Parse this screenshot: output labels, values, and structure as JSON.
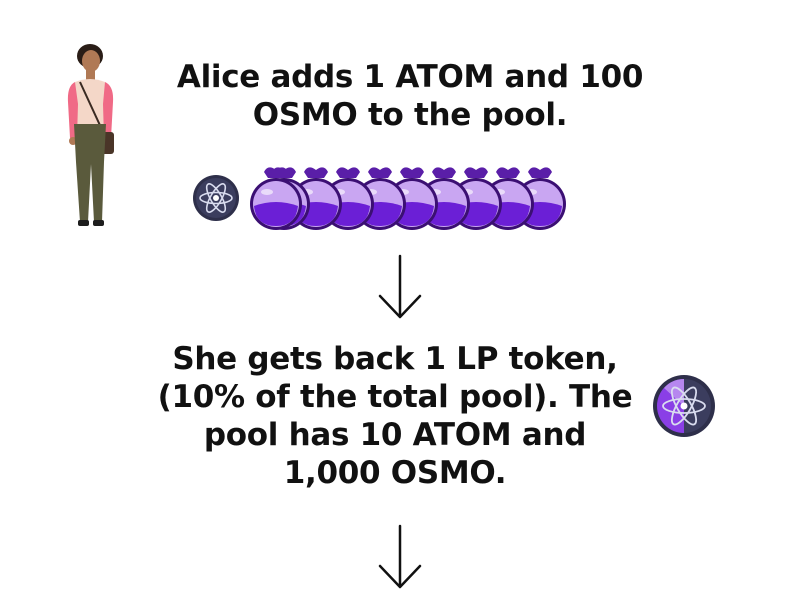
{
  "steps": [
    {
      "lines": [
        "Alice adds 1 ATOM and 100",
        "OSMO to the pool."
      ]
    },
    {
      "lines": [
        "She gets back 1 LP token,",
        "(10% of the total pool). The",
        "pool has 10 ATOM and",
        "1,000 OSMO."
      ]
    }
  ],
  "icons": {
    "person": "woman-illustration",
    "atom": "atom-token-icon",
    "osmo": "osmo-potion-icon",
    "lp": "lp-token-icon",
    "arrow": "arrow-down-icon"
  },
  "tokens": {
    "atom_count": 1,
    "osmo_count": 10
  },
  "colors": {
    "text": "#111111",
    "atom_bg": "#2e2f4a",
    "osmo_purple": "#6b1fd6",
    "osmo_glass": "#c9a6f2",
    "shirt": "#f06a86",
    "pants": "#5a5a3c"
  }
}
